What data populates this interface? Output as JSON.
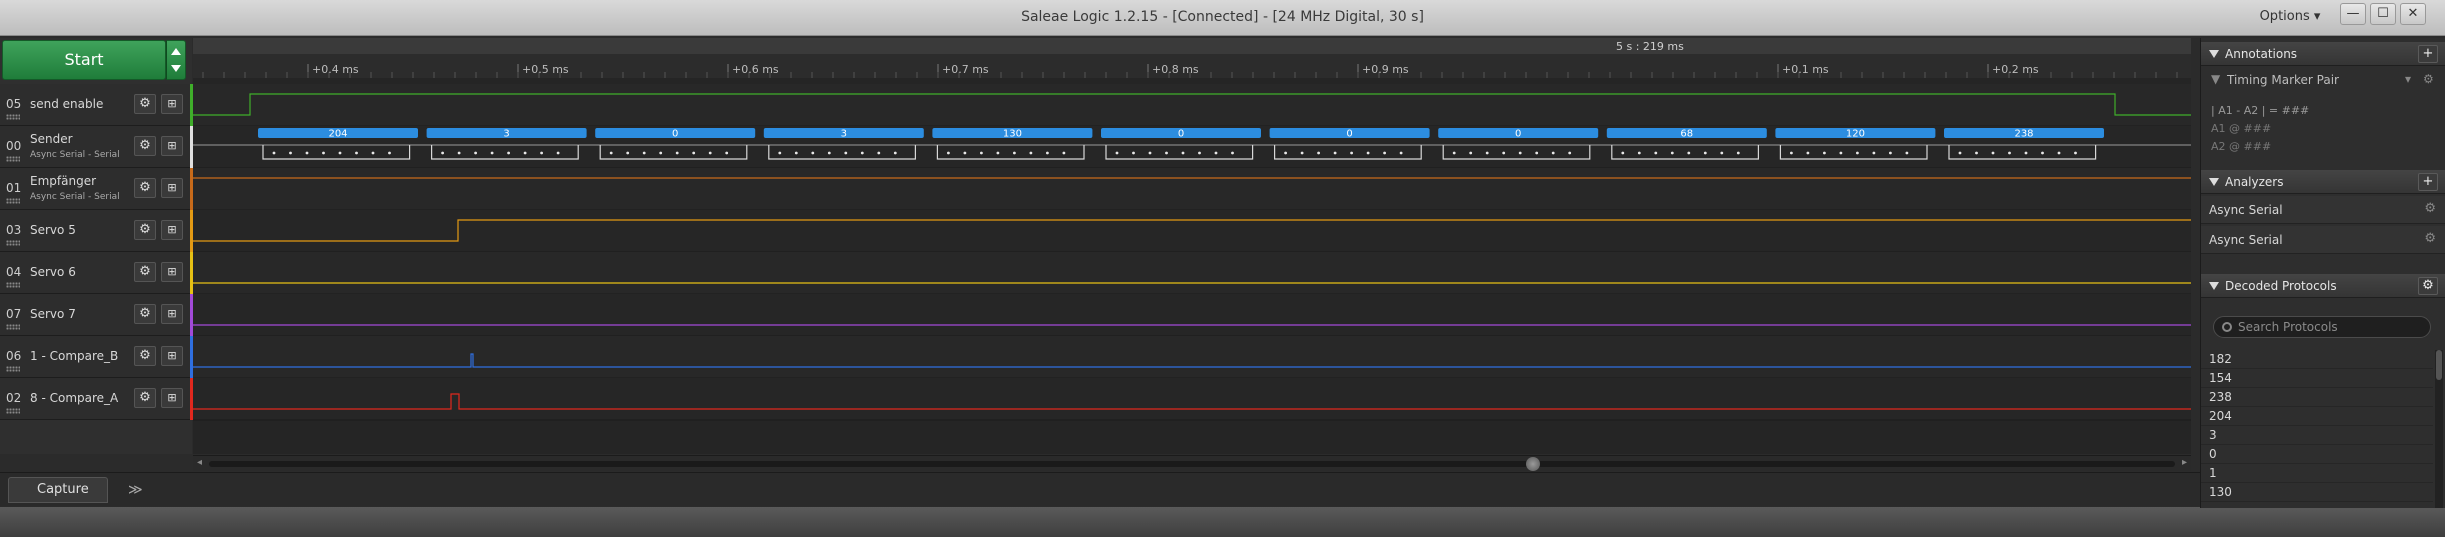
{
  "window": {
    "title": "Saleae Logic 1.2.15 - [Connected] - [24 MHz Digital, 30 s]",
    "options_label": "Options ▾",
    "min_glyph": "—",
    "max_glyph": "☐",
    "close_glyph": "✕"
  },
  "start": {
    "label": "Start"
  },
  "timeline": {
    "cursor_label": "5 s : 219 ms",
    "ticks": [
      {
        "label": "+0.4 ms",
        "ms": 0.4
      },
      {
        "label": "+0.5 ms",
        "ms": 0.5
      },
      {
        "label": "+0.6 ms",
        "ms": 0.6
      },
      {
        "label": "+0.7 ms",
        "ms": 0.7
      },
      {
        "label": "+0.8 ms",
        "ms": 0.8
      },
      {
        "label": "+0.9 ms",
        "ms": 0.9
      },
      {
        "label": "+0.1 ms",
        "ms": 1.1
      },
      {
        "label": "+0.2 ms",
        "ms": 1.2
      }
    ]
  },
  "channels": [
    {
      "num": "05",
      "name": "send enable",
      "sub": "",
      "color": "#3fae2a"
    },
    {
      "num": "00",
      "name": "Sender",
      "sub": "Async Serial - Serial",
      "color": "#e0e0e0"
    },
    {
      "num": "01",
      "name": "Empfänger",
      "sub": "Async Serial - Serial",
      "color": "#c76a1a"
    },
    {
      "num": "03",
      "name": "Servo 5",
      "sub": "",
      "color": "#e39a14"
    },
    {
      "num": "04",
      "name": "Servo 6",
      "sub": "",
      "color": "#e6c014"
    },
    {
      "num": "07",
      "name": "Servo 7",
      "sub": "",
      "color": "#a24ad8"
    },
    {
      "num": "06",
      "name": "1 - Compare_B",
      "sub": "",
      "color": "#2f6fe0"
    },
    {
      "num": "02",
      "name": "8 - Compare_A",
      "sub": "",
      "color": "#e0281e"
    }
  ],
  "decoded_bytes": [
    "204",
    "3",
    "0",
    "3",
    "130",
    "0",
    "0",
    "0",
    "68",
    "120",
    "238"
  ],
  "annotations": {
    "title": "Annotations",
    "add_glyph": "+",
    "marker_pair": "Timing Marker Pair",
    "a1a2_line": "| A1 - A2 | = ###",
    "a1_line": "A1 @ ###",
    "a2_line": "A2 @ ###"
  },
  "analyzers": {
    "title": "Analyzers",
    "add_glyph": "+",
    "items": [
      "Async Serial",
      "Async Serial"
    ]
  },
  "decoded_protocols": {
    "title": "Decoded Protocols",
    "search_placeholder": "Search Protocols",
    "items": [
      "182",
      "154",
      "238",
      "204",
      "3",
      "0",
      "1",
      "130"
    ]
  },
  "bottom": {
    "capture_tab": "Capture",
    "more_glyph": "≫"
  },
  "icons": {
    "gear": "⚙",
    "trigger": "⊞"
  }
}
